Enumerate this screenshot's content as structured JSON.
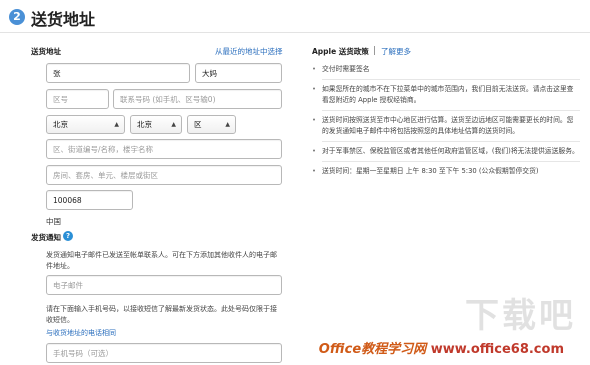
{
  "header": {
    "step": "2",
    "title": "送货地址"
  },
  "form": {
    "section_label": "送货地址",
    "recent_link": "从最近的地址中选择",
    "first_name": "张",
    "last_name": "大妈",
    "area_code_placeholder": "区号",
    "phone_placeholder": "联系号码 (如手机、区号输0)",
    "province": "北京",
    "city": "北京",
    "district": "区",
    "street_placeholder": "区、街道编号/名称，楼宇名称",
    "room_placeholder": "房间、套房、单元、楼层或街区",
    "zip": "100068",
    "country": "中国"
  },
  "notify": {
    "label": "发货通知",
    "help_icon": "?",
    "email_desc": "发货通知电子邮件已发送至帐单联系人。可在下方添加其他收件人的电子邮件地址。",
    "email_placeholder": "电子邮件",
    "sms_desc": "请在下面输入手机号码，以接收短信了解最新发货状态。此处号码仅限于接收短信。",
    "same_phone_link": "与收货地址的电话相同",
    "mobile_placeholder": "手机号码（可选）"
  },
  "policy": {
    "title": "Apple 送货政策",
    "learn_more": "了解更多",
    "bullets": [
      "交付时需要签名",
      "如果您所在的城市不在下拉菜单中的城市范围内，我们目前无法送货。请点击这里查看您附近的 Apple 授权经销商。",
      "送货时间按照送货至市中心地区进行估算。送货至边远地区可能需要更长的时间。您的发货通知电子邮件中将包括按照您的具体地址估算的送货时间。",
      "对于军事禁区、保税监管区或者其他任何政府监管区域，(我们)将无法提供运送服务。",
      "送货时间：星期一至星期日 上午 8:30 至下午 5:30 (公众假期暂停交货)"
    ]
  },
  "watermark": {
    "main": "下载吧",
    "site": "Office教程学习网",
    "url": "www.office68.com"
  }
}
